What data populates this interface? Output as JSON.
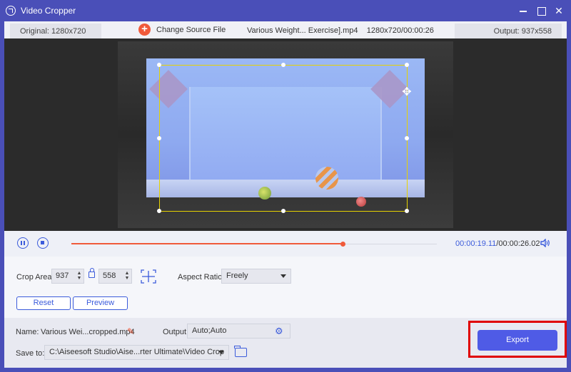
{
  "window": {
    "title": "Video Cropper",
    "minimize": "",
    "maximize": "",
    "close": "✕"
  },
  "infobar": {
    "original": "Original: 1280x720",
    "change_source": "Change Source File",
    "plus_symbol": "+",
    "file_info": "Various Weight... Exercise].mp4    1280x720/00:00:26",
    "output": "Output: 937x558"
  },
  "player": {
    "current_time": "00:00:19.11",
    "total_time": "/00:00:26.02",
    "progress_fraction": 0.742
  },
  "crop": {
    "area_label": "Crop Area:",
    "width": "937",
    "height": "558",
    "aspect_label": "Aspect Ratio:",
    "aspect_value": "Freely",
    "reset_label": "Reset",
    "preview_label": "Preview",
    "spin_up": "▲",
    "spin_down": "▼"
  },
  "bottom": {
    "name_label": "Name:",
    "name_value": "Various Wei...cropped.mp4",
    "output_label": "Output:",
    "output_value": "Auto;Auto",
    "save_label": "Save to:",
    "save_path": "C:\\Aiseesoft Studio\\Aise...rter Ultimate\\Video Crop",
    "export_label": "Export"
  },
  "icons": {
    "edit": "✎",
    "gear": "⚙",
    "move": "✥"
  },
  "colors": {
    "accent": "#3b5bdb",
    "titlebar": "#4a4fb8",
    "progress": "#f05a3a",
    "export_button": "#4f5be6",
    "highlight": "#e00000",
    "crop_border": "#e6d200"
  }
}
